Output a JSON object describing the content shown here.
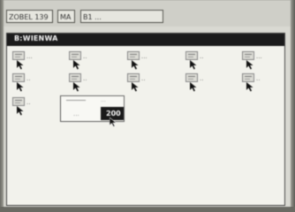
{
  "menubar": {
    "items": [
      {
        "label": "ZOBEL 139"
      },
      {
        "label": "MA"
      },
      {
        "label": "B1 ..."
      }
    ]
  },
  "window": {
    "title": "B:WIENWA"
  },
  "icons": [
    {
      "label": "...",
      "icon": "file-icon"
    },
    {
      "label": "..",
      "icon": "file-icon"
    },
    {
      "label": "...",
      "icon": "file-icon"
    },
    {
      "label": "..",
      "icon": "file-icon"
    },
    {
      "label": "...",
      "icon": "file-icon"
    },
    {
      "label": "..",
      "icon": "file-icon"
    },
    {
      "label": "..",
      "icon": "file-icon"
    },
    {
      "label": "..",
      "icon": "file-icon"
    },
    {
      "label": "..",
      "icon": "file-icon"
    },
    {
      "label": "..",
      "icon": "file-icon"
    },
    {
      "label": "..",
      "icon": "file-icon"
    }
  ],
  "dialog": {
    "hint": "...",
    "input_value": "...",
    "selected_value": "200"
  },
  "colors": {
    "titlebar": "#1b1b1b",
    "window_bg": "#f2f2ec",
    "selected_bg": "#1a1a1a"
  }
}
